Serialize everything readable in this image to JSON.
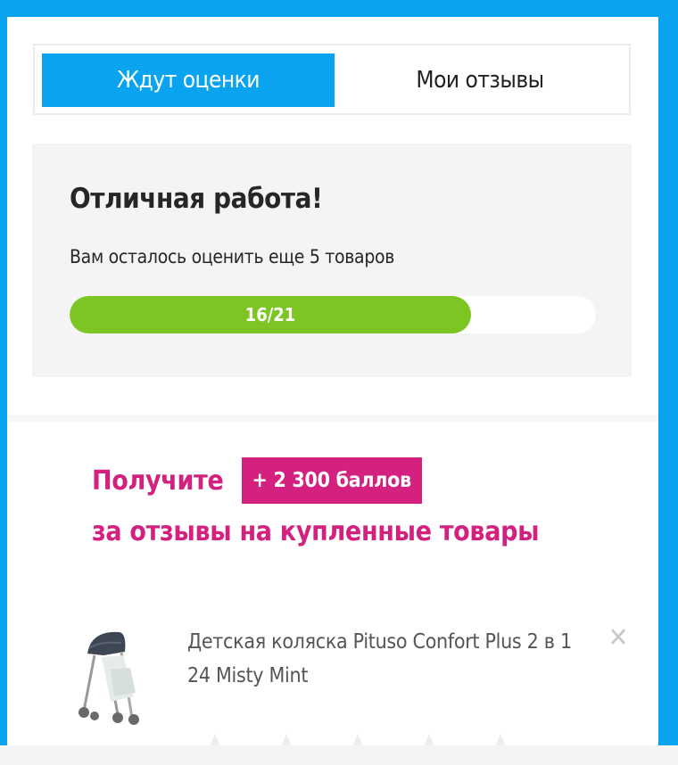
{
  "tabs": [
    {
      "label": "Ждут оценки",
      "active": true
    },
    {
      "label": "Мои отзывы",
      "active": false
    }
  ],
  "progress": {
    "title": "Отличная работа!",
    "subtitle": "Вам осталось оценить еще 5 товаров",
    "label": "16/21",
    "completed": 16,
    "total": 21,
    "fill_color": "#7cc522"
  },
  "promo": {
    "prefix": "Получите",
    "badge": "+ 2 300 баллов",
    "line2": "за отзывы на купленные товары",
    "color": "#d4217f"
  },
  "product": {
    "name": "Детская коляска Pituso Confort Plus 2 в 1 24 Misty Mint",
    "image_icon": "stroller-image",
    "close_icon": "close-icon",
    "rating": 0,
    "max_rating": 5
  },
  "colors": {
    "accent": "#0aa3ef",
    "panel_bg": "#f4f4f4"
  }
}
